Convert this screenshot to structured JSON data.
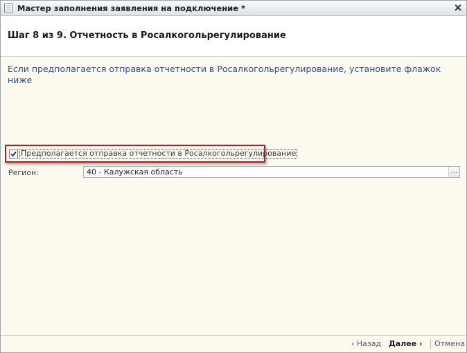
{
  "window": {
    "title": "Мастер заполнения заявления на подключение *",
    "icon": "form-icon",
    "close_icon": "close-icon"
  },
  "header": {
    "step_title": "Шаг 8 из 9. Отчетность в Росалкогольрегулирование"
  },
  "content": {
    "info_text": "Если предполагается отправка отчетности в Росалкогольрегулирование, установите флажок ниже",
    "checkbox": {
      "label": "Предполагается отправка отчетности в Росалкогольрегулирование",
      "checked": true
    },
    "region": {
      "label": "Регион:",
      "value": "40 - Калужская область",
      "select_button": "..."
    },
    "highlight_color": "#a81e22",
    "info_color": "#2a4d9b"
  },
  "footer": {
    "back_label": "Назад",
    "next_label": "Далее",
    "cancel_label": "Отмена"
  }
}
